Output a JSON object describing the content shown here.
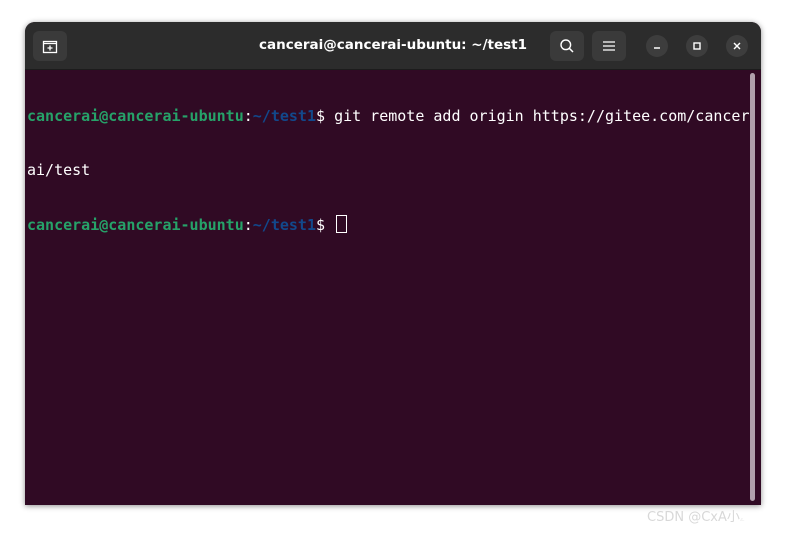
{
  "window": {
    "title": "cancerai@cancerai-ubuntu: ~/test1"
  },
  "icons": {
    "new_tab": "new-tab-icon",
    "search": "search-icon",
    "menu": "hamburger-menu-icon",
    "minimize": "minimize-icon",
    "maximize": "maximize-icon",
    "close": "close-icon"
  },
  "colors": {
    "terminal_bg": "#300a24",
    "prompt_user": "#26a269",
    "prompt_path": "#12488b",
    "text": "#ffffff",
    "titlebar": "#2c2c2c"
  },
  "terminal": {
    "lines": [
      {
        "user": "cancerai@cancerai-ubuntu",
        "colon": ":",
        "path": "~/test1",
        "symbol": "$ ",
        "command": "git remote add origin https://gitee.com/cancer"
      },
      {
        "output": "ai/test"
      },
      {
        "user": "cancerai@cancerai-ubuntu",
        "colon": ":",
        "path": "~/test1",
        "symbol": "$ ",
        "command": ""
      }
    ]
  },
  "watermark": "CSDN @CxA小ۦ"
}
